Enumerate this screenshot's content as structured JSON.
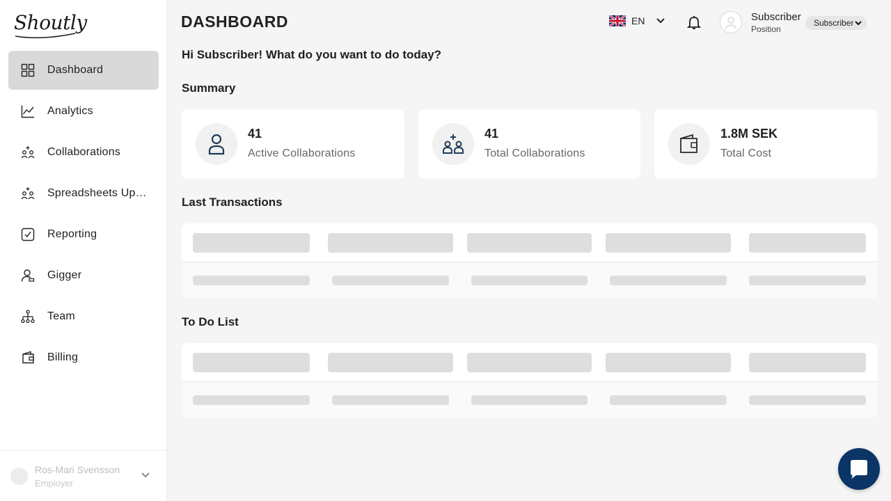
{
  "app": {
    "logo_text": "Shoutly"
  },
  "sidebar": {
    "items": [
      {
        "label": "Dashboard",
        "icon": "grid-icon",
        "active": true
      },
      {
        "label": "Analytics",
        "icon": "line-chart-icon"
      },
      {
        "label": "Collaborations",
        "icon": "collaborations-icon"
      },
      {
        "label": "Spreadsheets Uploads",
        "icon": "spreadsheet-upload-icon"
      },
      {
        "label": "Reporting",
        "icon": "checkbox-report-icon"
      },
      {
        "label": "Gigger",
        "icon": "gigger-user-icon"
      },
      {
        "label": "Team",
        "icon": "team-tree-icon"
      },
      {
        "label": "Billing",
        "icon": "wallet-icon"
      }
    ],
    "user": {
      "name": "Ros-Mari Svensson",
      "role": "Employer"
    }
  },
  "header": {
    "title": "DASHBOARD",
    "language": "EN",
    "user_name": "Subscriber",
    "user_position": "Position",
    "role_selected": "Subscriber"
  },
  "greeting": "Hi Subscriber! What do you want to do today?",
  "summary": {
    "title": "Summary",
    "cards": [
      {
        "value": "41",
        "caption": "Active Collaborations",
        "icon": "person-icon"
      },
      {
        "value": "41",
        "caption": "Total Collaborations",
        "icon": "group-add-icon"
      },
      {
        "value": "1.8M SEK",
        "caption": "Total Cost",
        "icon": "wallet-icon"
      }
    ]
  },
  "sections": {
    "transactions_title": "Last Transactions",
    "todo_title": "To Do List"
  },
  "colors": {
    "active_nav": "#d9d9d9",
    "background": "#f5f5f5",
    "chat_button": "#0b3566",
    "skeleton": "#dedede"
  }
}
